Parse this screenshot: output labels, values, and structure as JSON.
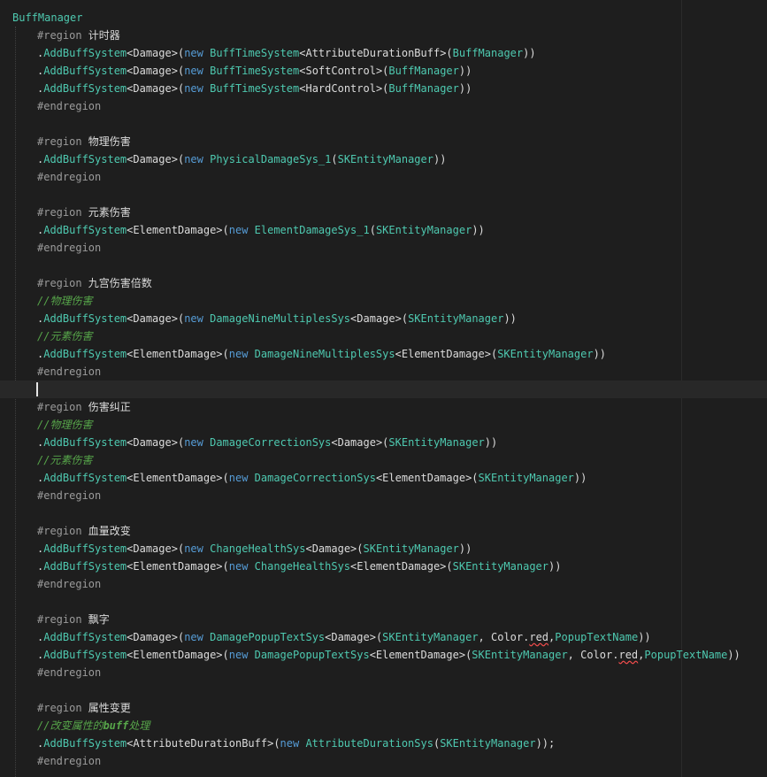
{
  "theme": {
    "background": "#1e1e1e",
    "type_color": "#4ec9b0",
    "keyword_color": "#569cd6",
    "directive_color": "#9b9b9b",
    "comment_color": "#57a64a",
    "text_color": "#dcdcdc",
    "error_underline": "#f14c4c"
  },
  "code_lines": [
    [
      {
        "t": "BuffManager",
        "c": "type"
      }
    ],
    [
      {
        "t": "#region ",
        "c": "dir"
      },
      {
        "t": "计时器",
        "c": "name"
      }
    ],
    [
      {
        "t": ".",
        "c": "plain"
      },
      {
        "t": "AddBuffSystem",
        "c": "type"
      },
      {
        "t": "<Damage>(",
        "c": "plain"
      },
      {
        "t": "new ",
        "c": "kw"
      },
      {
        "t": "BuffTimeSystem",
        "c": "type"
      },
      {
        "t": "<AttributeDurationBuff>(",
        "c": "plain"
      },
      {
        "t": "BuffManager",
        "c": "type"
      },
      {
        "t": "))",
        "c": "plain"
      }
    ],
    [
      {
        "t": ".",
        "c": "plain"
      },
      {
        "t": "AddBuffSystem",
        "c": "type"
      },
      {
        "t": "<Damage>(",
        "c": "plain"
      },
      {
        "t": "new ",
        "c": "kw"
      },
      {
        "t": "BuffTimeSystem",
        "c": "type"
      },
      {
        "t": "<SoftControl>(",
        "c": "plain"
      },
      {
        "t": "BuffManager",
        "c": "type"
      },
      {
        "t": "))",
        "c": "plain"
      }
    ],
    [
      {
        "t": ".",
        "c": "plain"
      },
      {
        "t": "AddBuffSystem",
        "c": "type"
      },
      {
        "t": "<Damage>(",
        "c": "plain"
      },
      {
        "t": "new ",
        "c": "kw"
      },
      {
        "t": "BuffTimeSystem",
        "c": "type"
      },
      {
        "t": "<HardControl>(",
        "c": "plain"
      },
      {
        "t": "BuffManager",
        "c": "type"
      },
      {
        "t": "))",
        "c": "plain"
      }
    ],
    [
      {
        "t": "#endregion",
        "c": "dir"
      }
    ],
    [],
    [
      {
        "t": "#region ",
        "c": "dir"
      },
      {
        "t": "物理伤害",
        "c": "name"
      }
    ],
    [
      {
        "t": ".",
        "c": "plain"
      },
      {
        "t": "AddBuffSystem",
        "c": "type"
      },
      {
        "t": "<Damage>(",
        "c": "plain"
      },
      {
        "t": "new ",
        "c": "kw"
      },
      {
        "t": "PhysicalDamageSys_1",
        "c": "type"
      },
      {
        "t": "(",
        "c": "plain"
      },
      {
        "t": "SKEntityManager",
        "c": "type"
      },
      {
        "t": "))",
        "c": "plain"
      }
    ],
    [
      {
        "t": "#endregion",
        "c": "dir"
      }
    ],
    [],
    [
      {
        "t": "#region ",
        "c": "dir"
      },
      {
        "t": "元素伤害",
        "c": "name"
      }
    ],
    [
      {
        "t": ".",
        "c": "plain"
      },
      {
        "t": "AddBuffSystem",
        "c": "type"
      },
      {
        "t": "<ElementDamage>(",
        "c": "plain"
      },
      {
        "t": "new ",
        "c": "kw"
      },
      {
        "t": "ElementDamageSys_1",
        "c": "type"
      },
      {
        "t": "(",
        "c": "plain"
      },
      {
        "t": "SKEntityManager",
        "c": "type"
      },
      {
        "t": "))",
        "c": "plain"
      }
    ],
    [
      {
        "t": "#endregion",
        "c": "dir"
      }
    ],
    [],
    [
      {
        "t": "#region ",
        "c": "dir"
      },
      {
        "t": "九宫伤害倍数",
        "c": "name"
      }
    ],
    [
      {
        "t": "//物理伤害",
        "c": "comment"
      }
    ],
    [
      {
        "t": ".",
        "c": "plain"
      },
      {
        "t": "AddBuffSystem",
        "c": "type"
      },
      {
        "t": "<Damage>(",
        "c": "plain"
      },
      {
        "t": "new ",
        "c": "kw"
      },
      {
        "t": "DamageNineMultiplesSys",
        "c": "type"
      },
      {
        "t": "<Damage>(",
        "c": "plain"
      },
      {
        "t": "SKEntityManager",
        "c": "type"
      },
      {
        "t": "))",
        "c": "plain"
      }
    ],
    [
      {
        "t": "//元素伤害",
        "c": "comment"
      }
    ],
    [
      {
        "t": ".",
        "c": "plain"
      },
      {
        "t": "AddBuffSystem",
        "c": "type"
      },
      {
        "t": "<ElementDamage>(",
        "c": "plain"
      },
      {
        "t": "new ",
        "c": "kw"
      },
      {
        "t": "DamageNineMultiplesSys",
        "c": "type"
      },
      {
        "t": "<ElementDamage>(",
        "c": "plain"
      },
      {
        "t": "SKEntityManager",
        "c": "type"
      },
      {
        "t": "))",
        "c": "plain"
      }
    ],
    [
      {
        "t": "#endregion",
        "c": "dir"
      }
    ],
    [],
    [
      {
        "t": "#region ",
        "c": "dir"
      },
      {
        "t": "伤害纠正",
        "c": "name"
      }
    ],
    [
      {
        "t": "//物理伤害",
        "c": "comment"
      }
    ],
    [
      {
        "t": ".",
        "c": "plain"
      },
      {
        "t": "AddBuffSystem",
        "c": "type"
      },
      {
        "t": "<Damage>(",
        "c": "plain"
      },
      {
        "t": "new ",
        "c": "kw"
      },
      {
        "t": "DamageCorrectionSys",
        "c": "type"
      },
      {
        "t": "<Damage>(",
        "c": "plain"
      },
      {
        "t": "SKEntityManager",
        "c": "type"
      },
      {
        "t": "))",
        "c": "plain"
      }
    ],
    [
      {
        "t": "//元素伤害",
        "c": "comment"
      }
    ],
    [
      {
        "t": ".",
        "c": "plain"
      },
      {
        "t": "AddBuffSystem",
        "c": "type"
      },
      {
        "t": "<ElementDamage>(",
        "c": "plain"
      },
      {
        "t": "new ",
        "c": "kw"
      },
      {
        "t": "DamageCorrectionSys",
        "c": "type"
      },
      {
        "t": "<ElementDamage>(",
        "c": "plain"
      },
      {
        "t": "SKEntityManager",
        "c": "type"
      },
      {
        "t": "))",
        "c": "plain"
      }
    ],
    [
      {
        "t": "#endregion",
        "c": "dir"
      }
    ],
    [],
    [
      {
        "t": "#region ",
        "c": "dir"
      },
      {
        "t": "血量改变",
        "c": "name"
      }
    ],
    [
      {
        "t": ".",
        "c": "plain"
      },
      {
        "t": "AddBuffSystem",
        "c": "type"
      },
      {
        "t": "<Damage>(",
        "c": "plain"
      },
      {
        "t": "new ",
        "c": "kw"
      },
      {
        "t": "ChangeHealthSys",
        "c": "type"
      },
      {
        "t": "<Damage>(",
        "c": "plain"
      },
      {
        "t": "SKEntityManager",
        "c": "type"
      },
      {
        "t": "))",
        "c": "plain"
      }
    ],
    [
      {
        "t": ".",
        "c": "plain"
      },
      {
        "t": "AddBuffSystem",
        "c": "type"
      },
      {
        "t": "<ElementDamage>(",
        "c": "plain"
      },
      {
        "t": "new ",
        "c": "kw"
      },
      {
        "t": "ChangeHealthSys",
        "c": "type"
      },
      {
        "t": "<ElementDamage>(",
        "c": "plain"
      },
      {
        "t": "SKEntityManager",
        "c": "type"
      },
      {
        "t": "))",
        "c": "plain"
      }
    ],
    [
      {
        "t": "#endregion",
        "c": "dir"
      }
    ],
    [],
    [
      {
        "t": "#region ",
        "c": "dir"
      },
      {
        "t": "飘字",
        "c": "name"
      }
    ],
    [
      {
        "t": ".",
        "c": "plain"
      },
      {
        "t": "AddBuffSystem",
        "c": "type"
      },
      {
        "t": "<Damage>(",
        "c": "plain"
      },
      {
        "t": "new ",
        "c": "kw"
      },
      {
        "t": "DamagePopupTextSys",
        "c": "type"
      },
      {
        "t": "<Damage>(",
        "c": "plain"
      },
      {
        "t": "SKEntityManager",
        "c": "type"
      },
      {
        "t": ", Color.",
        "c": "plain"
      },
      {
        "t": "red",
        "c": "squiggle"
      },
      {
        "t": ",",
        "c": "plain"
      },
      {
        "t": "PopupTextName",
        "c": "type"
      },
      {
        "t": "))",
        "c": "plain"
      }
    ],
    [
      {
        "t": ".",
        "c": "plain"
      },
      {
        "t": "AddBuffSystem",
        "c": "type"
      },
      {
        "t": "<ElementDamage>(",
        "c": "plain"
      },
      {
        "t": "new ",
        "c": "kw"
      },
      {
        "t": "DamagePopupTextSys",
        "c": "type"
      },
      {
        "t": "<ElementDamage>(",
        "c": "plain"
      },
      {
        "t": "SKEntityManager",
        "c": "type"
      },
      {
        "t": ", Color.",
        "c": "plain"
      },
      {
        "t": "red",
        "c": "squiggle"
      },
      {
        "t": ",",
        "c": "plain"
      },
      {
        "t": "PopupTextName",
        "c": "type"
      },
      {
        "t": "))",
        "c": "plain"
      }
    ],
    [
      {
        "t": "#endregion",
        "c": "dir"
      }
    ],
    [],
    [
      {
        "t": "#region ",
        "c": "dir"
      },
      {
        "t": "属性变更",
        "c": "name"
      }
    ],
    [
      {
        "t": "//改变属性的",
        "c": "comment"
      },
      {
        "t": "buff",
        "c": "commentbold"
      },
      {
        "t": "处理",
        "c": "comment"
      }
    ],
    [
      {
        "t": ".",
        "c": "plain"
      },
      {
        "t": "AddBuffSystem",
        "c": "type"
      },
      {
        "t": "<AttributeDurationBuff>(",
        "c": "plain"
      },
      {
        "t": "new ",
        "c": "kw"
      },
      {
        "t": "AttributeDurationSys",
        "c": "type"
      },
      {
        "t": "(",
        "c": "plain"
      },
      {
        "t": "SKEntityManager",
        "c": "type"
      },
      {
        "t": "));",
        "c": "plain"
      }
    ],
    [
      {
        "t": "#endregion",
        "c": "dir"
      }
    ]
  ]
}
